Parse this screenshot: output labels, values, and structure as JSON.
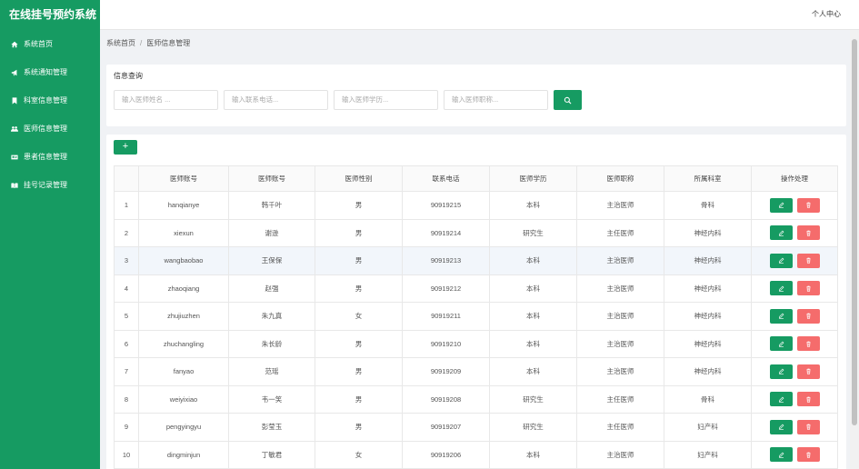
{
  "app": {
    "title": "在线挂号预约系统"
  },
  "sidebar": {
    "items": [
      {
        "label": "系统首页",
        "icon": "home-icon"
      },
      {
        "label": "系统通知管理",
        "icon": "bullhorn-icon"
      },
      {
        "label": "科室信息管理",
        "icon": "bookmark-icon"
      },
      {
        "label": "医师信息管理",
        "icon": "users-icon"
      },
      {
        "label": "患者信息管理",
        "icon": "id-card-icon"
      },
      {
        "label": "挂号记录管理",
        "icon": "book-open-icon"
      }
    ]
  },
  "header": {
    "user_label": "个人中心"
  },
  "breadcrumb": {
    "home": "系统首页",
    "current": "医师信息管理"
  },
  "search": {
    "title": "信息查询",
    "name_placeholder": "输入医师姓名 ...",
    "phone_placeholder": "输入联系电话...",
    "education_placeholder": "输入医师学历...",
    "title_placeholder": "输入医师职称..."
  },
  "table": {
    "columns": [
      "",
      "医师账号",
      "医师账号",
      "医师性别",
      "联系电话",
      "医师学历",
      "医师职称",
      "所属科室",
      "操作处理"
    ],
    "rows": [
      [
        "1",
        "hanqianye",
        "韩千叶",
        "男",
        "90919215",
        "本科",
        "主治医师",
        "骨科"
      ],
      [
        "2",
        "xiexun",
        "谢逊",
        "男",
        "90919214",
        "研究生",
        "主任医师",
        "神经内科"
      ],
      [
        "3",
        "wangbaobao",
        "王保保",
        "男",
        "90919213",
        "本科",
        "主治医师",
        "神经内科"
      ],
      [
        "4",
        "zhaoqiang",
        "赵强",
        "男",
        "90919212",
        "本科",
        "主治医师",
        "神经内科"
      ],
      [
        "5",
        "zhujiuzhen",
        "朱九真",
        "女",
        "90919211",
        "本科",
        "主治医师",
        "神经内科"
      ],
      [
        "6",
        "zhuchangling",
        "朱长龄",
        "男",
        "90919210",
        "本科",
        "主治医师",
        "神经内科"
      ],
      [
        "7",
        "fanyao",
        "范瑶",
        "男",
        "90919209",
        "本科",
        "主治医师",
        "神经内科"
      ],
      [
        "8",
        "weiyixiao",
        "韦一笑",
        "男",
        "90919208",
        "研究生",
        "主任医师",
        "骨科"
      ],
      [
        "9",
        "pengyingyu",
        "彭莹玉",
        "男",
        "90919207",
        "研究生",
        "主任医师",
        "妇产科"
      ],
      [
        "10",
        "dingminjun",
        "丁敏君",
        "女",
        "90919206",
        "本科",
        "主治医师",
        "妇产科"
      ]
    ]
  },
  "colors": {
    "primary": "#169b62",
    "danger": "#f56c6c",
    "background": "#f0f2f5"
  }
}
